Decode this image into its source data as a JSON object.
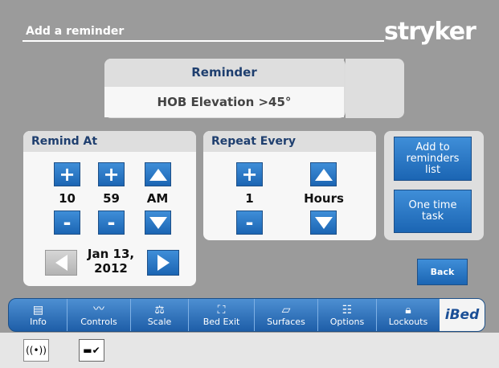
{
  "header": {
    "title": "Add a reminder",
    "brand": "stryker"
  },
  "reminder": {
    "heading": "Reminder",
    "value": "HOB Elevation >45°"
  },
  "remind_at": {
    "heading": "Remind At",
    "hour": "10",
    "minute": "59",
    "ampm": "AM",
    "date_line1": "Jan 13,",
    "date_line2": "2012"
  },
  "repeat_every": {
    "heading": "Repeat Every",
    "count": "1",
    "unit": "Hours"
  },
  "actions": {
    "add_line1": "Add to",
    "add_line2": "reminders",
    "add_line3": "list",
    "one_time_line1": "One time",
    "one_time_line2": "task"
  },
  "back_label": "Back",
  "tabs": [
    {
      "label": "Info",
      "icon": "info-doc-icon"
    },
    {
      "label": "Controls",
      "icon": "patient-bed-icon"
    },
    {
      "label": "Scale",
      "icon": "scale-icon"
    },
    {
      "label": "Bed Exit",
      "icon": "bed-exit-icon"
    },
    {
      "label": "Surfaces",
      "icon": "mattress-icon"
    },
    {
      "label": "Options",
      "icon": "sliders-icon"
    },
    {
      "label": "Lockouts",
      "icon": "lock-icon"
    },
    {
      "label": "iBed",
      "icon": "ibed-logo"
    }
  ],
  "footer": {
    "icons": [
      "wireless-signal-icon",
      "bed-check-icon"
    ]
  },
  "colors": {
    "accent": "#1b65b3",
    "background": "#9b9b9b",
    "heading": "#1f3f6f"
  }
}
